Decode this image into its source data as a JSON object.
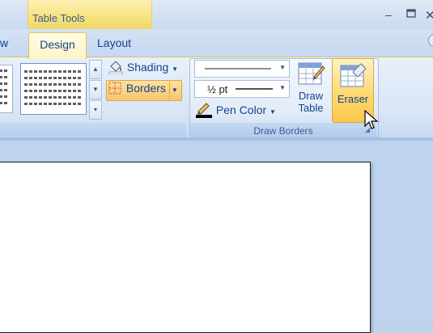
{
  "title_bar": {
    "context_tab": "Table Tools",
    "window_controls": [
      "minimize-icon",
      "maximize-icon",
      "close-icon"
    ]
  },
  "tabs": {
    "partial_left": "w",
    "design": "Design",
    "layout": "Layout"
  },
  "table_styles_group": {
    "shading_label": "Shading",
    "borders_label": "Borders"
  },
  "draw_borders_group": {
    "line_weight_value": "½ pt",
    "pen_color_label": "Pen Color",
    "draw_table_line1": "Draw",
    "draw_table_line2": "Table",
    "eraser_label": "Eraser",
    "group_label": "Draw Borders"
  },
  "colors": {
    "ribbon_accent": "#f9c56c",
    "ribbon_blue": "#c5d8f1",
    "text_blue": "#15428b"
  }
}
